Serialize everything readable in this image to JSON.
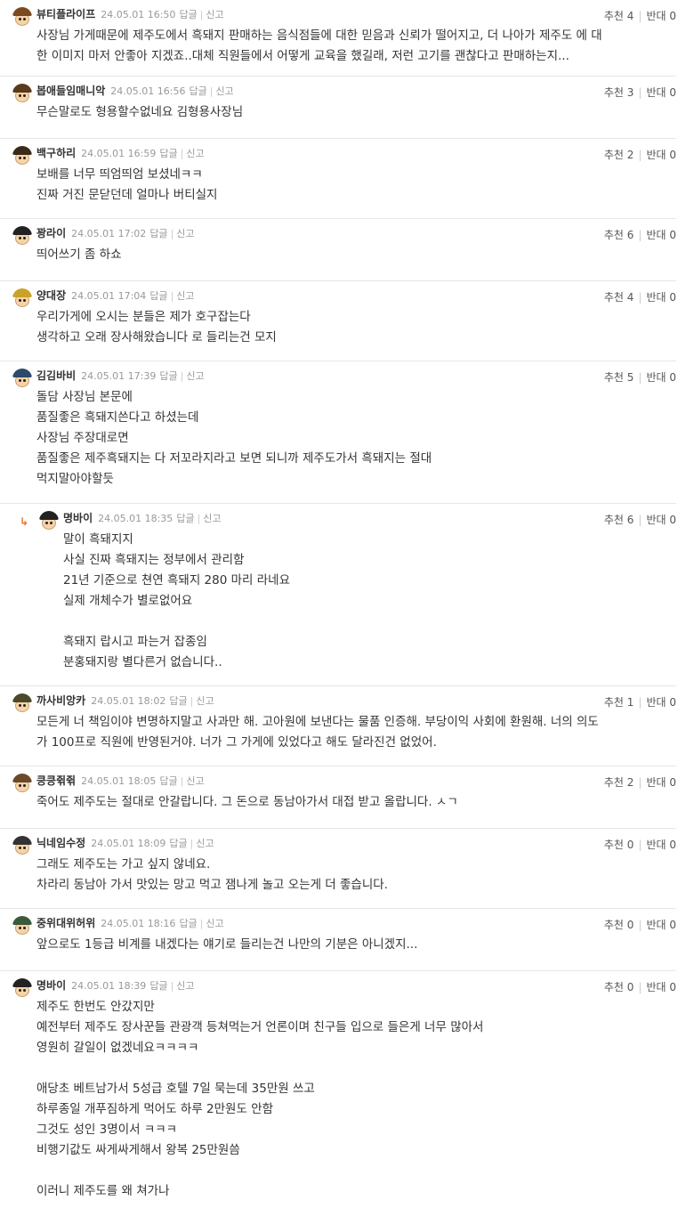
{
  "labels": {
    "reply": "답글",
    "report": "신고",
    "upvote": "추천",
    "downvote": "반대"
  },
  "comments": [
    {
      "nick": "뷰티플라이프",
      "date": "24.05.01 16:50",
      "up": 4,
      "down": 0,
      "hair": "#7b4a1e",
      "lines": [
        "사장님 가게때문에 제주도에서 흑돼지 판매하는 음식점들에 대한 믿음과 신뢰가 떨어지고, 더 나아가 제주도 에 대",
        "한 이미지 마저 안좋아 지겠죠..대체 직원들에서 어떻게 교육을 했길래, 저런 고기를 괜찮다고 판매하는지..."
      ]
    },
    {
      "nick": "봅애들임매니악",
      "date": "24.05.01 16:56",
      "up": 3,
      "down": 0,
      "hair": "#5a3a1a",
      "lines": [
        "무슨말로도 형용할수없네요 김형용사장님"
      ]
    },
    {
      "nick": "백구하리",
      "date": "24.05.01 16:59",
      "up": 2,
      "down": 0,
      "hair": "#3a2a18",
      "lines": [
        "보배를 너무 띄엄띄엄 보셨네ㅋㅋ",
        "진짜 거진 문닫던데 얼마나 버티실지"
      ]
    },
    {
      "nick": "꽝라이",
      "date": "24.05.01 17:02",
      "up": 6,
      "down": 0,
      "hair": "#222222",
      "lines": [
        "띄어쓰기 좀 하쇼"
      ]
    },
    {
      "nick": "양대장",
      "date": "24.05.01 17:04",
      "up": 4,
      "down": 0,
      "hair": "#c9a227",
      "lines": [
        "우리가게에 오시는 분들은 제가 호구잡는다",
        "생각하고 오래 장사해왔습니다 로 들리는건 모지"
      ]
    },
    {
      "nick": "김김바비",
      "date": "24.05.01 17:39",
      "up": 5,
      "down": 0,
      "hair": "#2c4a6b",
      "lines": [
        "돌담 사장님 본문에",
        "품질좋은 흑돼지쓴다고 하셨는데",
        "사장님 주장대로면",
        "품질좋은 제주흑돼지는 다 저꼬라지라고 보면 되니까 제주도가서 흑돼지는 절대",
        "먹지말아야할듯"
      ]
    },
    {
      "nick": "명바이",
      "date": "24.05.01 18:35",
      "up": 6,
      "down": 0,
      "hair": "#222222",
      "reply": true,
      "lines": [
        "말이 흑돼지지",
        "사실 진짜 흑돼지는 정부에서 관리함",
        "21년 기준으로 쳔연 흑돼지 280 마리 라네요",
        "실제 개체수가 별로없어요",
        "",
        "흑돼지 랍시고 파는거 잡종임",
        "분홍돼지랑 별다른거 없습니다.."
      ]
    },
    {
      "nick": "까사비앙카",
      "date": "24.05.01 18:02",
      "up": 1,
      "down": 0,
      "hair": "#4a4a2a",
      "lines": [
        "모든게 너 책임이야 변명하지말고 사과만 해. 고아원에 보낸다는 물품 인증해. 부당이익 사회에 환원해. 너의 의도",
        "가 100프로 직원에 반영된거야. 너가 그 가게에 있었다고 해도 달라진건 없었어."
      ]
    },
    {
      "nick": "킁킁쥒쥒",
      "date": "24.05.01 18:05",
      "up": 2,
      "down": 0,
      "hair": "#6b4a2a",
      "lines": [
        "죽어도 제주도는 절대로 안갈랍니다. 그 돈으로 동남아가서 대접 받고 올랍니다. ㅅㄱ"
      ]
    },
    {
      "nick": "닉네임수정",
      "date": "24.05.01 18:09",
      "up": 0,
      "down": 0,
      "hair": "#333333",
      "lines": [
        "그래도 제주도는 가고 싶지 않네요.",
        "차라리 동남아 가서 맛있는 망고 먹고 잼나게 놀고 오는게 더 좋습니다."
      ]
    },
    {
      "nick": "중위대위허위",
      "date": "24.05.01 18:16",
      "up": 0,
      "down": 0,
      "hair": "#3a5a3a",
      "lines": [
        "앞으로도 1등급 비계를 내겠다는 얘기로 들리는건 나만의 기분은 아니겠지..."
      ]
    },
    {
      "nick": "명바이",
      "date": "24.05.01 18:39",
      "up": 0,
      "down": 0,
      "hair": "#222222",
      "lines": [
        "제주도 한번도 안갔지만",
        "예전부터 제주도 장사꾼들 관광객 등쳐먹는거 언론이며 친구들 입으로 들은게 너무 많아서",
        "영원히 갈일이 없겠네요ㅋㅋㅋㅋ",
        "",
        "애당초 베트남가서 5성급 호텔 7일 묵는데 35만원 쓰고",
        "하루종일 개푸짐하게 먹어도 하루 2만원도 안함",
        "그것도 성인 3명이서 ㅋㅋㅋ",
        "비행기값도 싸게싸게해서 왕복 25만원씀",
        "",
        "이러니 제주도를 왜 쳐가나"
      ]
    }
  ]
}
